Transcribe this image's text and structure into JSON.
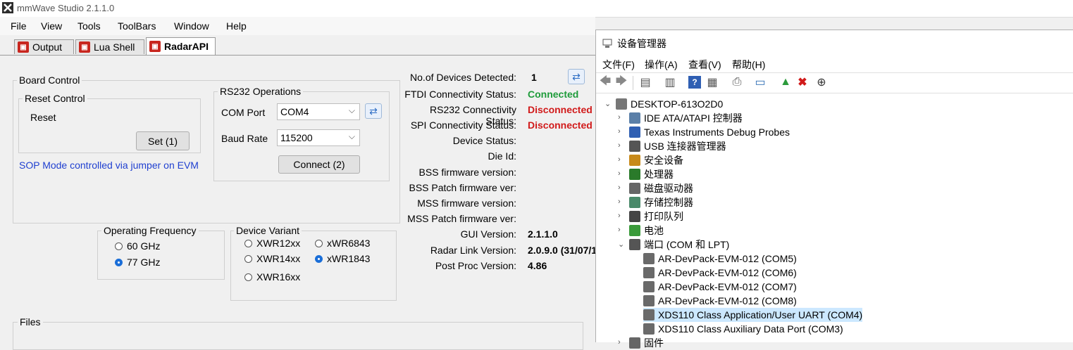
{
  "window": {
    "title": "mmWave Studio 2.1.1.0"
  },
  "menu": [
    "File",
    "View",
    "Tools",
    "ToolBars",
    "Window",
    "Help"
  ],
  "tabs": [
    "Output",
    "Lua Shell",
    "RadarAPI"
  ],
  "board_control": {
    "title": "Board Control",
    "reset_group": "Reset Control",
    "reset_label": "Reset",
    "set_button": "Set (1)",
    "sop_note": "SOP Mode controlled via jumper on EVM"
  },
  "rs232": {
    "title": "RS232 Operations",
    "com_port_label": "COM Port",
    "com_port_value": "COM4",
    "baud_label": "Baud Rate",
    "baud_value": "115200",
    "connect_button": "Connect (2)"
  },
  "status": [
    {
      "label": "No.of Devices Detected:",
      "value": "1",
      "color": "#000000"
    },
    {
      "label": "FTDI Connectivity Status:",
      "value": "Connected",
      "color": "#1e9b3a"
    },
    {
      "label": "RS232 Connectivity Status:",
      "value": "Disconnected",
      "color": "#d11a1a"
    },
    {
      "label": "SPI Connectivity Status:",
      "value": "Disconnected",
      "color": "#d11a1a"
    },
    {
      "label": "Device Status:",
      "value": "",
      "color": "#000000"
    },
    {
      "label": "Die Id:",
      "value": "",
      "color": "#000000"
    },
    {
      "label": "BSS firmware version:",
      "value": "",
      "color": "#000000"
    },
    {
      "label": "BSS Patch firmware ver:",
      "value": "",
      "color": "#000000"
    },
    {
      "label": "MSS firmware version:",
      "value": "",
      "color": "#000000"
    },
    {
      "label": "MSS Patch firmware ver:",
      "value": "",
      "color": "#000000"
    },
    {
      "label": "GUI Version:",
      "value": "2.1.1.0",
      "color": "#000000"
    },
    {
      "label": "Radar Link Version:",
      "value": "2.0.9.0 (31/07/1",
      "color": "#000000"
    },
    {
      "label": "Post Proc Version:",
      "value": "4.86",
      "color": "#000000"
    }
  ],
  "operating_frequency": {
    "title": "Operating Frequency",
    "options": [
      {
        "label": "60 GHz",
        "checked": false
      },
      {
        "label": "77 GHz",
        "checked": true
      }
    ]
  },
  "device_variant": {
    "title": "Device Variant",
    "options": [
      {
        "label": "XWR12xx",
        "checked": false
      },
      {
        "label": "xWR6843",
        "checked": false
      },
      {
        "label": "XWR14xx",
        "checked": false
      },
      {
        "label": "xWR1843",
        "checked": true
      },
      {
        "label": "XWR16xx",
        "checked": false
      }
    ]
  },
  "files": {
    "title": "Files"
  },
  "device_manager": {
    "title": "设备管理器",
    "menu": [
      "文件(F)",
      "操作(A)",
      "查看(V)",
      "帮助(H)"
    ],
    "root": "DESKTOP-613O2D0",
    "categories": [
      "IDE ATA/ATAPI 控制器",
      "Texas Instruments Debug Probes",
      "USB 连接器管理器",
      "安全设备",
      "处理器",
      "磁盘驱动器",
      "存储控制器",
      "打印队列",
      "电池",
      "端口 (COM 和 LPT)"
    ],
    "ports": [
      "AR-DevPack-EVM-012 (COM5)",
      "AR-DevPack-EVM-012 (COM6)",
      "AR-DevPack-EVM-012 (COM7)",
      "AR-DevPack-EVM-012 (COM8)",
      "XDS110 Class Application/User UART (COM4)",
      "XDS110 Class Auxiliary Data Port (COM3)"
    ],
    "partial_next": "固件",
    "selected_port": "XDS110 Class Application/User UART (COM4)"
  }
}
